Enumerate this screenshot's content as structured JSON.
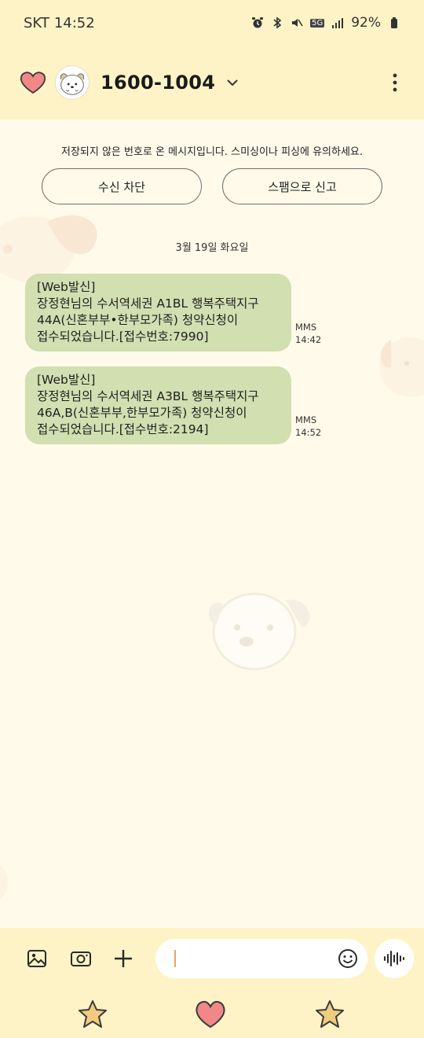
{
  "statusbar": {
    "carrier": "SKT",
    "time": "14:52",
    "network": "5G",
    "battery": "92%"
  },
  "header": {
    "title": "1600-1004"
  },
  "notice": {
    "text": "저장되지 않은 번호로 온 메시지입니다. 스미싱이나 피싱에 유의하세요.",
    "block_label": "수신 차단",
    "spam_label": "스팸으로 신고"
  },
  "date_divider": "3월 19일 화요일",
  "messages": [
    {
      "lines": [
        "[Web발신]",
        "장정현님의 수서역세권 A1BL 행복주택지구",
        "44A(신혼부부•한부모가족) 청약신청이",
        "접수되었습니다.[접수번호:7990]"
      ],
      "type": "MMS",
      "time": "14:42"
    },
    {
      "lines": [
        "[Web발신]",
        "장정현님의 수서역세권 A3BL 행복주택지구",
        "46A,B(신혼부부,한부모가족) 청약신청이",
        "접수되었습니다.[접수번호:2194]"
      ],
      "type": "MMS",
      "time": "14:52"
    }
  ],
  "colors": {
    "bar": "#fdf3c6",
    "background": "#fffaea",
    "bubble": "#d2dfb1",
    "heart": "#f08888",
    "star": "#f0cb80"
  }
}
